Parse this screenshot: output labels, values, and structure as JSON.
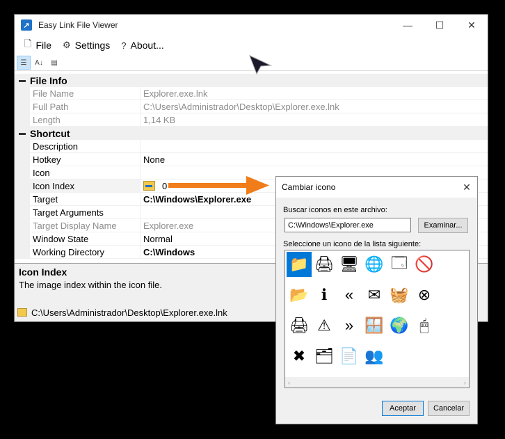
{
  "window": {
    "title": "Easy Link File Viewer",
    "minimize": "—",
    "maximize": "☐",
    "close": "✕"
  },
  "menu": {
    "file": "File",
    "settings": "Settings",
    "about": "About..."
  },
  "grid": {
    "categories": {
      "file_info": "File Info",
      "shortcut": "Shortcut"
    },
    "file_info": [
      {
        "name": "File Name",
        "value": "Explorer.exe.lnk"
      },
      {
        "name": "Full Path",
        "value": "C:\\Users\\Administrador\\Desktop\\Explorer.exe.lnk"
      },
      {
        "name": "Length",
        "value": "1,14 KB"
      }
    ],
    "shortcut": [
      {
        "name": "Description",
        "value": ""
      },
      {
        "name": "Hotkey",
        "value": "None"
      },
      {
        "name": "Icon",
        "value": ""
      },
      {
        "name": "Icon Index",
        "value": "0"
      },
      {
        "name": "Target",
        "value": "C:\\Windows\\Explorer.exe"
      },
      {
        "name": "Target Arguments",
        "value": ""
      },
      {
        "name": "Target Display Name",
        "value": "Explorer.exe"
      },
      {
        "name": "Window State",
        "value": "Normal"
      },
      {
        "name": "Working Directory",
        "value": "C:\\Windows"
      }
    ]
  },
  "help": {
    "title": "Icon Index",
    "description": "The image index within the icon file."
  },
  "status": {
    "path": "C:\\Users\\Administrador\\Desktop\\Explorer.exe.lnk"
  },
  "dialog": {
    "title": "Cambiar icono",
    "close": "✕",
    "search_label": "Buscar iconos en este archivo:",
    "file_value": "C:\\Windows\\Explorer.exe",
    "browse": "Examinar...",
    "list_label": "Seleccione un icono de la lista siguiente:",
    "ok": "Aceptar",
    "cancel": "Cancelar",
    "icons": [
      {
        "name": "folder-icon",
        "glyph": "📁"
      },
      {
        "name": "printer-help-icon",
        "glyph": "🖨"
      },
      {
        "name": "computer-icon",
        "glyph": "🖥"
      },
      {
        "name": "globe-icon",
        "glyph": "🌐"
      },
      {
        "name": "windows-icon",
        "glyph": "🗔"
      },
      {
        "name": "blocked-document-icon",
        "glyph": "🚫"
      },
      {
        "name": "folder-up-icon",
        "glyph": "📂"
      },
      {
        "name": "info-icon",
        "glyph": "ℹ"
      },
      {
        "name": "double-left-icon",
        "glyph": "«"
      },
      {
        "name": "mail-icon",
        "glyph": "✉"
      },
      {
        "name": "shopping-basket-icon",
        "glyph": "🧺"
      },
      {
        "name": "circle-x-icon",
        "glyph": "⊗"
      },
      {
        "name": "printer-icon",
        "glyph": "🖨"
      },
      {
        "name": "warning-icon",
        "glyph": "⚠"
      },
      {
        "name": "double-right-icon",
        "glyph": "»"
      },
      {
        "name": "app-window-icon",
        "glyph": "🪟"
      },
      {
        "name": "internet-icon",
        "glyph": "🌍"
      },
      {
        "name": "desktop-arrow-icon",
        "glyph": "🖱"
      },
      {
        "name": "error-icon",
        "glyph": "✖"
      },
      {
        "name": "folder-zip-icon",
        "glyph": "🗂"
      },
      {
        "name": "document-icon",
        "glyph": "📄"
      },
      {
        "name": "users-icon",
        "glyph": "👥"
      }
    ]
  }
}
